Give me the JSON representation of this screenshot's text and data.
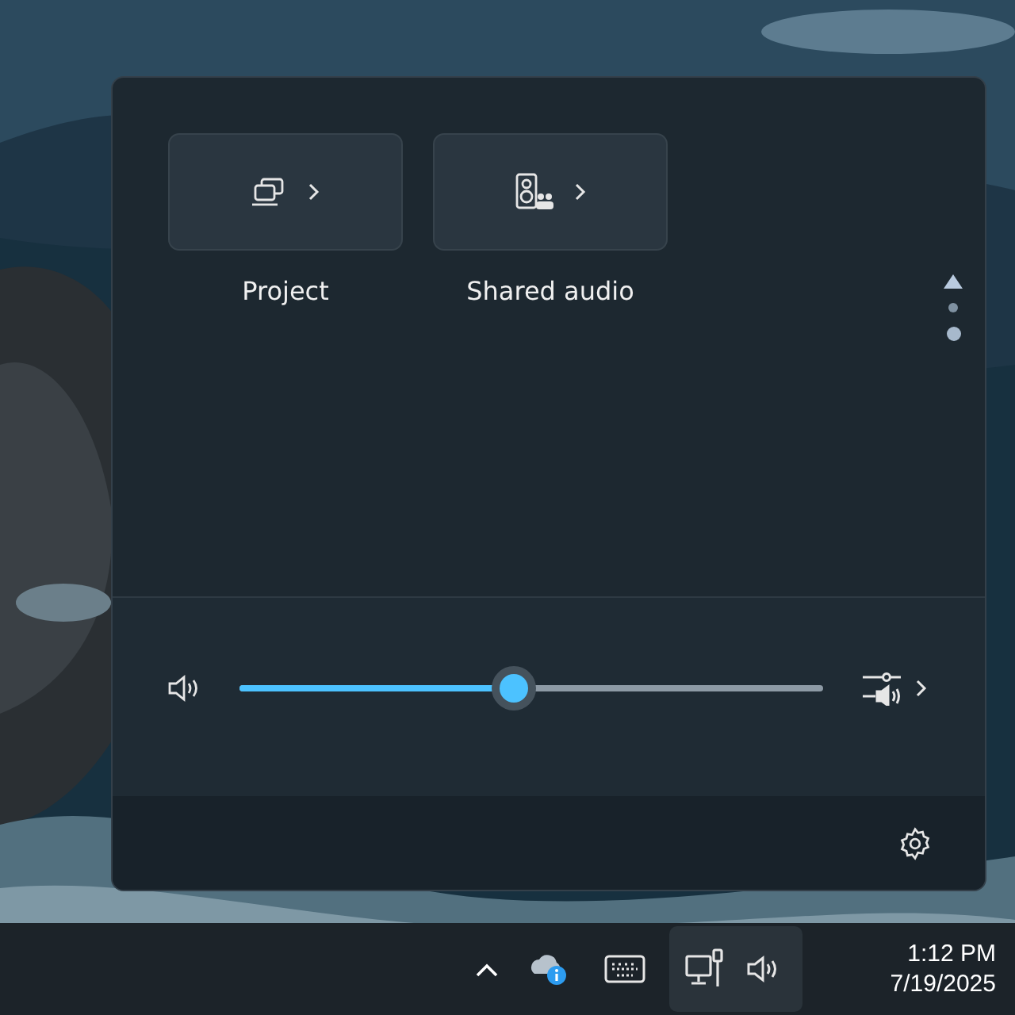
{
  "quick_actions": [
    {
      "kind": "project",
      "label": "Project"
    },
    {
      "kind": "shared-audio",
      "label": "Shared audio"
    }
  ],
  "pager": {
    "pages": [
      {
        "selected": false
      },
      {
        "selected": true
      }
    ]
  },
  "volume": {
    "level": 0.47
  },
  "taskbar": {
    "time": "1:12 PM",
    "date": "7/19/2025",
    "tray_selected": true
  }
}
